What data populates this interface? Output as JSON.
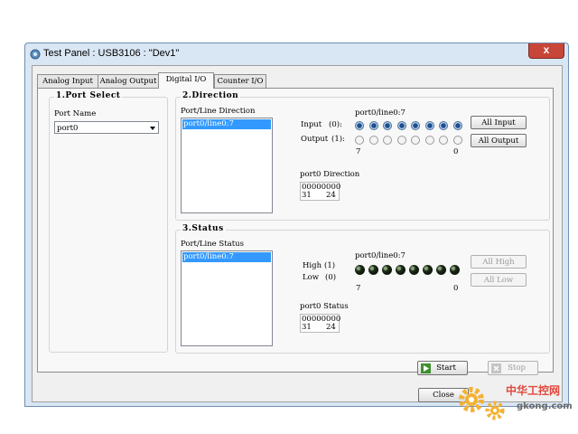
{
  "window": {
    "title": "Test Panel : USB3106 : \"Dev1\"",
    "close_icon": "close-icon",
    "close_glyph": "x"
  },
  "tabs": [
    {
      "label": "Analog Input",
      "active": false
    },
    {
      "label": "Analog Output",
      "active": false
    },
    {
      "label": "Digital I/O",
      "active": true
    },
    {
      "label": "Counter I/O",
      "active": false
    }
  ],
  "port_select": {
    "title": "1.Port Select",
    "port_name_label": "Port Name",
    "port_name_value": "port0"
  },
  "direction": {
    "title": "2.Direction",
    "list_label": "Port/Line Direction",
    "list_items": [
      "port0/line0:7"
    ],
    "lines_label": "port0/line0:7",
    "input_label": "Input",
    "input_code": "(0):",
    "output_label": "Output",
    "output_code": "(1):",
    "line_states": [
      "input",
      "input",
      "input",
      "input",
      "input",
      "input",
      "input",
      "input"
    ],
    "index_high": "7",
    "index_low": "0",
    "all_input_label": "All Input",
    "all_output_label": "All Output",
    "value_label": "port0 Direction",
    "value_bits": "00000000",
    "value_range_hi": "31",
    "value_range_lo": "24"
  },
  "status": {
    "title": "3.Status",
    "list_label": "Port/Line Status",
    "list_items": [
      "port0/line0:7"
    ],
    "lines_label": "port0/line0:7",
    "high_label": "High",
    "high_code": "(1)",
    "low_label": "Low",
    "low_code": "(0)",
    "led_levels": [
      0,
      0,
      0,
      0,
      0,
      0,
      0,
      0
    ],
    "index_high": "7",
    "index_low": "0",
    "all_high_label": "All High",
    "all_low_label": "All Low",
    "value_label": "port0 Status",
    "value_bits": "00000000",
    "value_range_hi": "31",
    "value_range_lo": "24"
  },
  "buttons": {
    "start_label": "Start",
    "stop_label": "Stop",
    "close_label": "Close"
  },
  "watermark": {
    "text_cn": "中华工控网",
    "text_url": "gkong.com"
  }
}
